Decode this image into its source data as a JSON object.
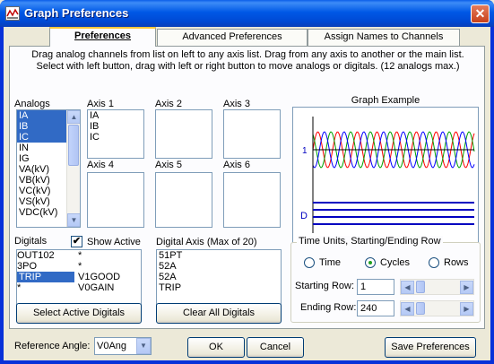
{
  "window": {
    "title": "Graph Preferences",
    "close_glyph": "✕"
  },
  "tabs": [
    {
      "label": "Preferences"
    },
    {
      "label": "Advanced Preferences"
    },
    {
      "label": "Assign Names to Channels"
    }
  ],
  "instructions": {
    "line1": "Drag analog channels from list on left to any axis list. Drag from any axis to another or the main list.",
    "line2": "Select with left button, drag with left or right button to move analogs or digitals. (12 analogs max.)"
  },
  "analogs": {
    "label": "Analogs",
    "items": [
      "IA",
      "IB",
      "IC",
      "IN",
      "IG",
      "VA(kV)",
      "VB(kV)",
      "VC(kV)",
      "VS(kV)",
      "VDC(kV)"
    ],
    "selected": [
      0,
      1,
      2
    ]
  },
  "axes": [
    {
      "label": "Axis 1",
      "items": [
        "IA",
        "IB",
        "IC"
      ]
    },
    {
      "label": "Axis 2",
      "items": []
    },
    {
      "label": "Axis 3",
      "items": []
    },
    {
      "label": "Axis 4",
      "items": []
    },
    {
      "label": "Axis 5",
      "items": []
    },
    {
      "label": "Axis 6",
      "items": []
    }
  ],
  "graph": {
    "title": "Graph Example",
    "label_analog": "1",
    "label_digital": "D",
    "colors": {
      "phase_a": "#ff0000",
      "phase_b": "#00a000",
      "phase_c": "#0000ff",
      "digital": "#0000c0",
      "axis": "#000000"
    }
  },
  "digitals": {
    "label": "Digitals",
    "show_active_label": "Show Active",
    "show_active_checked": "✔",
    "rows": [
      {
        "name": "OUT102",
        "mark": "*",
        "name2": ""
      },
      {
        "name": "3PO",
        "mark": "*",
        "name2": ""
      },
      {
        "name": "TRIP",
        "mark": "",
        "name2": "V1GOOD"
      },
      {
        "name": "*",
        "mark": "",
        "name2": "V0GAIN"
      }
    ],
    "selected_row": 2
  },
  "digital_axis": {
    "label": "Digital Axis (Max of 20)",
    "items": [
      "51PT",
      "52A",
      "52A",
      "TRIP"
    ]
  },
  "time_units": {
    "title": "Time Units, Starting/Ending Row",
    "options": [
      "Time",
      "Cycles",
      "Rows"
    ],
    "selected": "Cycles",
    "starting_row_label": "Starting Row:",
    "starting_row_value": "1",
    "ending_row_label": "Ending Row:",
    "ending_row_value": "240"
  },
  "buttons": {
    "select_active": "Select Active Digitals",
    "clear_all": "Clear All Digitals",
    "ok": "OK",
    "cancel": "Cancel",
    "save": "Save Preferences"
  },
  "reference_angle": {
    "label": "Reference Angle:",
    "value": "V0Ang"
  },
  "scroll_glyphs": {
    "up": "▲",
    "down": "▼",
    "left": "◀",
    "right": "▶"
  }
}
